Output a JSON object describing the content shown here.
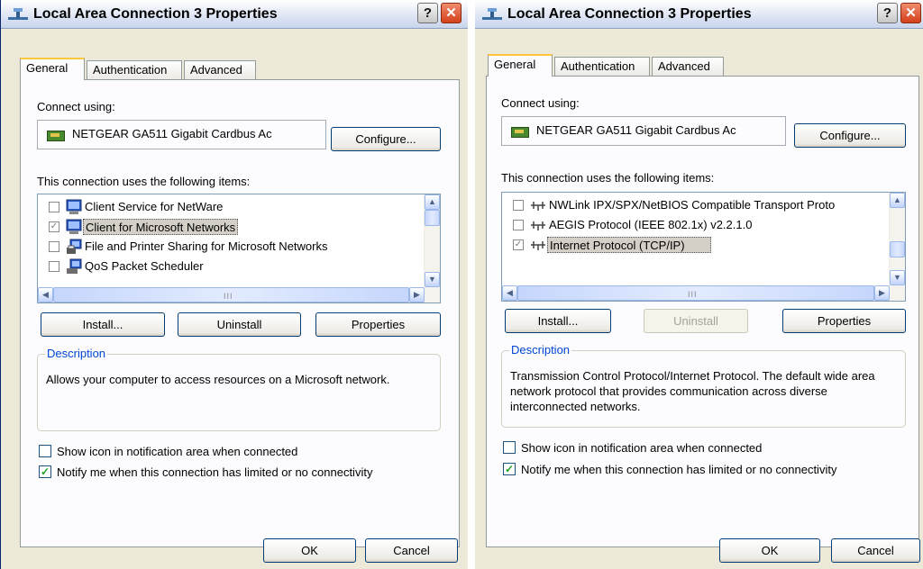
{
  "left": {
    "title": "Local Area Connection 3 Properties",
    "tabs": [
      "General",
      "Authentication",
      "Advanced"
    ],
    "connect_using_label": "Connect using:",
    "adapter_name": "NETGEAR GA511 Gigabit Cardbus Ac",
    "configure_label": "Configure...",
    "items_label": "This connection uses the following items:",
    "items": [
      {
        "label": "Client Service for NetWare",
        "checked": false,
        "icon": "network-client-icon"
      },
      {
        "label": "Client for Microsoft Networks",
        "checked": true,
        "selected": true,
        "icon": "network-client-icon"
      },
      {
        "label": "File and Printer Sharing for Microsoft Networks",
        "checked": false,
        "icon": "file-printer-sharing-icon"
      },
      {
        "label": "QoS Packet Scheduler",
        "checked": false,
        "icon": "network-service-icon"
      }
    ],
    "install_label": "Install...",
    "uninstall_label": "Uninstall",
    "properties_label": "Properties",
    "description_legend": "Description",
    "description_text": "Allows your computer to access resources on a Microsoft network.",
    "show_icon_label": "Show icon in notification area when connected",
    "show_icon_checked": false,
    "notify_label": "Notify me when this connection has limited or no connectivity",
    "notify_checked": true,
    "ok_label": "OK",
    "cancel_label": "Cancel"
  },
  "right": {
    "title": "Local Area Connection 3 Properties",
    "tabs": [
      "General",
      "Authentication",
      "Advanced"
    ],
    "connect_using_label": "Connect using:",
    "adapter_name": "NETGEAR GA511 Gigabit Cardbus Ac",
    "configure_label": "Configure...",
    "items_label": "This connection uses the following items:",
    "items": [
      {
        "label": "NWLink IPX/SPX/NetBIOS Compatible Transport Proto",
        "checked": false,
        "icon": "protocol-icon"
      },
      {
        "label": "AEGIS Protocol (IEEE 802.1x) v2.2.1.0",
        "checked": false,
        "icon": "protocol-icon"
      },
      {
        "label": "Internet Protocol (TCP/IP)",
        "checked": true,
        "selected": true,
        "icon": "protocol-icon"
      }
    ],
    "install_label": "Install...",
    "uninstall_label": "Uninstall",
    "uninstall_disabled": true,
    "properties_label": "Properties",
    "description_legend": "Description",
    "description_text": "Transmission Control Protocol/Internet Protocol. The default wide area network protocol that provides communication across diverse interconnected networks.",
    "show_icon_label": "Show icon in notification area when connected",
    "show_icon_checked": false,
    "notify_label": "Notify me when this connection has limited or no connectivity",
    "notify_checked": true,
    "ok_label": "OK",
    "cancel_label": "Cancel"
  },
  "colors": {
    "dialog_bg": "#ece9d8",
    "panel_bg": "#fcfcfe",
    "close_button": "#d3401a",
    "group_legend": "#0046d5",
    "check_green": "#21a121"
  }
}
